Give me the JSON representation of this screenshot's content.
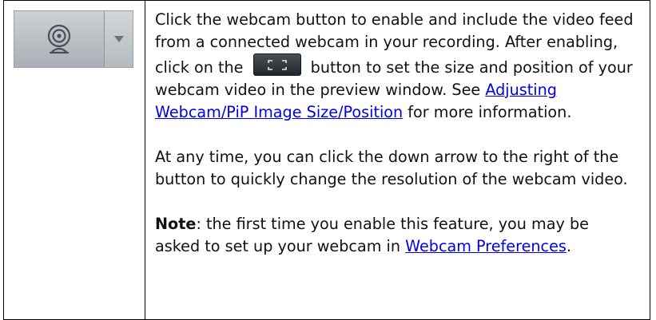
{
  "webcam_widget": {
    "icon": "webcam-icon",
    "arrow_icon": "dropdown-arrow-icon"
  },
  "description": {
    "p1_before": "Click the webcam button to enable and include the video feed from a connected webcam in your recording. After enabling, click on the ",
    "inline_button_icon": "pip-frame-icon",
    "p1_after": " button to set the size and position of your webcam video in the preview window. See ",
    "p1_link": "Adjusting Webcam/PiP Image Size/Position",
    "p1_end": " for more information.",
    "p2": "At any time, you can click the down arrow to the right of the button to quickly change the resolution of the webcam video.",
    "note_label": "Note",
    "note_text": ": the first time you enable this feature, you may be asked to set up your webcam in ",
    "note_link": "Webcam Preferences",
    "note_end": "."
  },
  "colors": {
    "link": "#0000ee",
    "border": "#000000"
  }
}
